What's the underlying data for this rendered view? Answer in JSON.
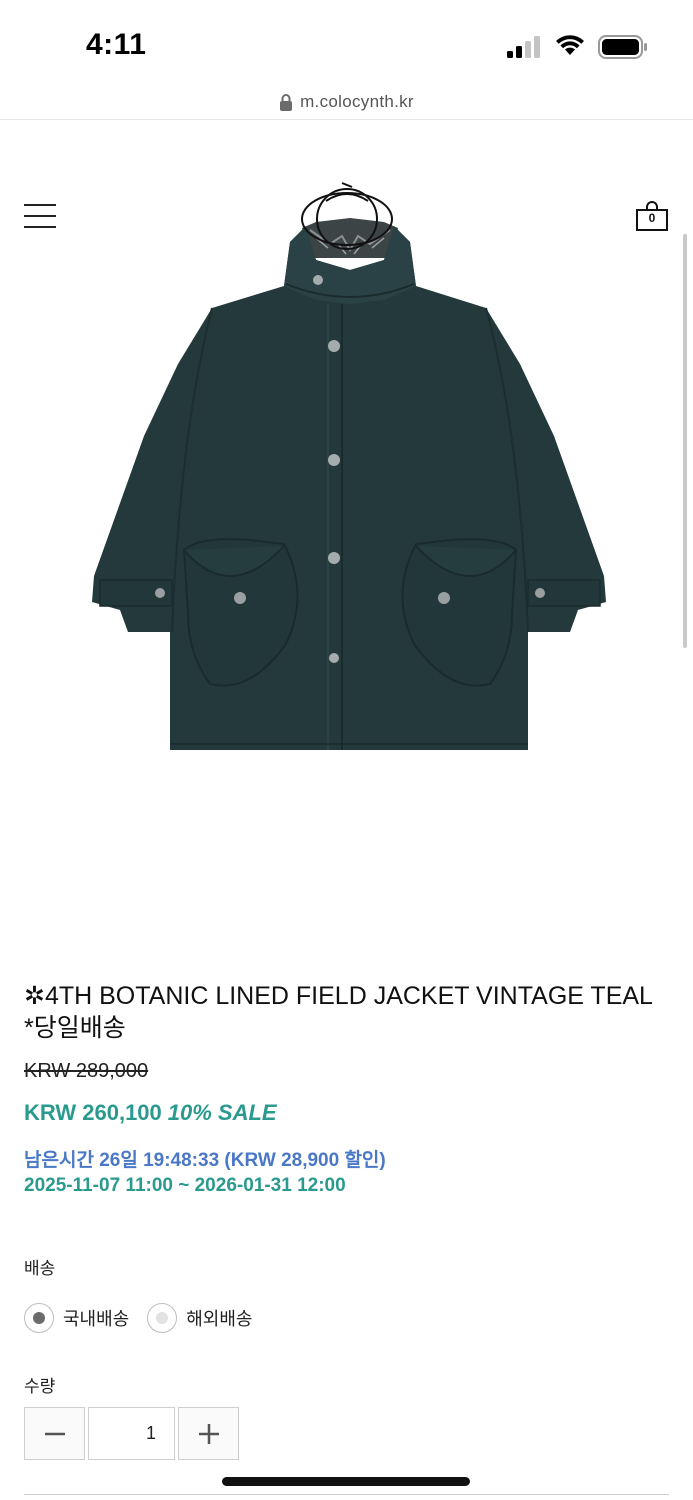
{
  "status_bar": {
    "time": "4:11"
  },
  "browser": {
    "url": "m.colocynth.kr"
  },
  "header": {
    "cart_count": "0",
    "menu_icon": "hamburger-menu-icon",
    "cart_icon": "shopping-bag-icon"
  },
  "product": {
    "title": "✲4TH BOTANIC LINED FIELD JACKET VINTAGE TEAL *당일배송",
    "price_original": "KRW 289,000",
    "price_sale": "KRW 260,100",
    "sale_tag": "10% SALE",
    "countdown": "남은시간 26일 19:48:33 (KRW 28,900 할인)",
    "period": "2025-11-07 11:00 ~ 2026-01-31 12:00"
  },
  "options": {
    "shipping_label": "배송",
    "shipping_choices": [
      {
        "label": "국내배송",
        "selected": true
      },
      {
        "label": "해외배송",
        "selected": false
      }
    ],
    "quantity_label": "수량",
    "quantity_value": "1"
  },
  "colors": {
    "accent_teal": "#2a9a8e",
    "countdown_blue": "#4a78c7",
    "jacket": "#24393c"
  }
}
